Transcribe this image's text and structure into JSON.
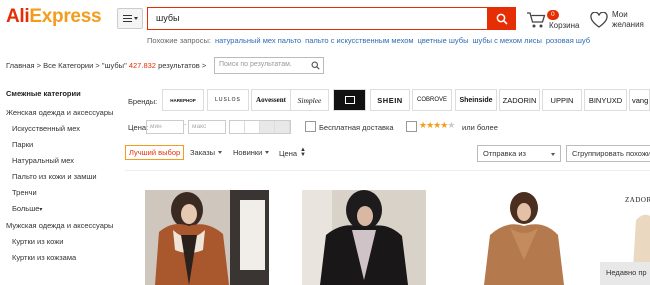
{
  "header": {
    "logo_main": "Ali",
    "logo_accent": "Express",
    "search_value": "шубы",
    "related_label": "Похожие запросы:",
    "related": [
      "натуральный мех пальто",
      "пальто с искусственным мехом",
      "цветные шубы",
      "шубы с мехом лисы",
      "розовая шуб"
    ],
    "cart_count": "0",
    "cart_label": "Корзина",
    "wish_line1": "Мои",
    "wish_line2": "желания"
  },
  "breadcrumb": {
    "home": "Главная",
    "sep1": " > ",
    "all": "Все Категории",
    "sep2": " > ",
    "query": "\"шубы\"",
    "count": "427.832",
    "results": "результатов >",
    "inner_search_placeholder": "Поиск по результатам."
  },
  "sidebar": {
    "title": "Смежные категории",
    "items": [
      {
        "label": "Женская одежда и аксессуары",
        "sub": false
      },
      {
        "label": "Искусственный мех",
        "sub": true
      },
      {
        "label": "Парки",
        "sub": true
      },
      {
        "label": "Натуральный мех",
        "sub": true
      },
      {
        "label": "Пальто из кожи и замши",
        "sub": true
      },
      {
        "label": "Тренчи",
        "sub": true
      },
      {
        "label": "Больше",
        "sub": true
      },
      {
        "label": "Мужская одежда и аксессуары",
        "sub": false
      },
      {
        "label": "Куртки из кожи",
        "sub": true
      },
      {
        "label": "Куртки из кожзама",
        "sub": true
      }
    ]
  },
  "brands": {
    "label": "Бренды:",
    "items": [
      "HAREPHOP",
      "LUSLOS",
      "Aovessent",
      "Simplee",
      "",
      "SHEIN",
      "COBROVE",
      "Sheinside",
      "ZADORIN",
      "UPPIN",
      "BINYUXD",
      "vang"
    ]
  },
  "filters": {
    "price_label": "Цена:",
    "min_placeholder": "мин",
    "max_placeholder": "макс",
    "dash": "-",
    "free_shipping": "Бесплатная доставка",
    "rating_more": "или более",
    "rating_stars": 4
  },
  "sort": {
    "best": "Лучший выбор",
    "orders": "Заказы",
    "new": "Новинки",
    "price": "Цена",
    "ship_from": "Отправка из",
    "group_similar": "Сгруппировать похожие"
  },
  "products": {
    "brand_overlay": "ZADOR",
    "recent": "Недавно пр"
  }
}
